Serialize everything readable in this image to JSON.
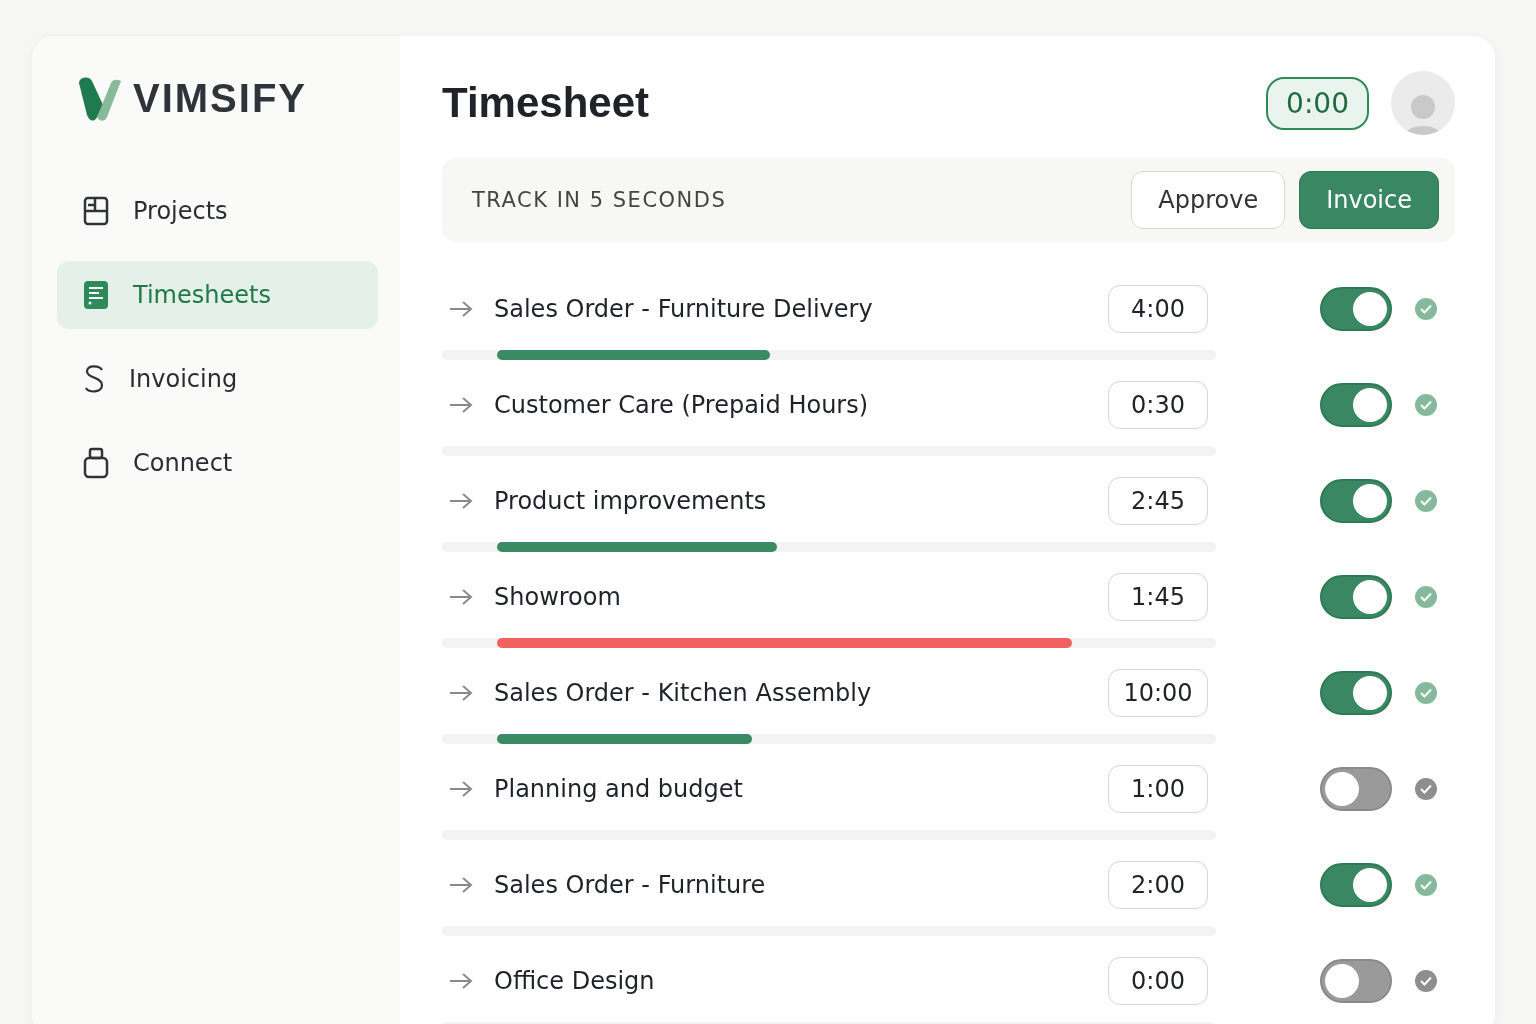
{
  "brand": {
    "name": "VIMSIFY"
  },
  "sidebar": {
    "items": [
      {
        "label": "Projects",
        "selected": false
      },
      {
        "label": "Timesheets",
        "selected": true
      },
      {
        "label": "Invoicing",
        "selected": false
      },
      {
        "label": "Connect",
        "selected": false
      }
    ]
  },
  "header": {
    "title": "Timesheet",
    "timer": "0:00"
  },
  "toolbar": {
    "label": "TRACK IN 5 SECONDS",
    "buttons": [
      {
        "label": "Approve",
        "kind": "secondary"
      },
      {
        "label": "Invoice",
        "kind": "primary"
      }
    ]
  },
  "entries": [
    {
      "name": "Sales Order - Furniture Delivery",
      "time": "4:00",
      "on": true,
      "progress": {
        "level": 0.38,
        "color": "#3a8a64"
      }
    },
    {
      "name": "Customer Care (Prepaid Hours)",
      "time": "0:30",
      "on": true
    },
    {
      "name": "Product improvements",
      "time": "2:45",
      "on": true,
      "progress": {
        "level": 0.39,
        "color": "#3a8a64"
      }
    },
    {
      "name": "Showroom",
      "time": "1:45",
      "on": true,
      "progress": {
        "level": 0.8,
        "color": "#f26060"
      }
    },
    {
      "name": "Sales Order - Kitchen Assembly",
      "time": "10:00",
      "on": true,
      "progress": {
        "level": 0.355,
        "color": "#3a8a64"
      }
    },
    {
      "name": "Planning and budget",
      "time": "1:00",
      "on": false
    },
    {
      "name": "Sales Order - Furniture",
      "time": "2:00",
      "on": true
    },
    {
      "name": "Office Design",
      "time": "0:00",
      "on": false
    }
  ]
}
